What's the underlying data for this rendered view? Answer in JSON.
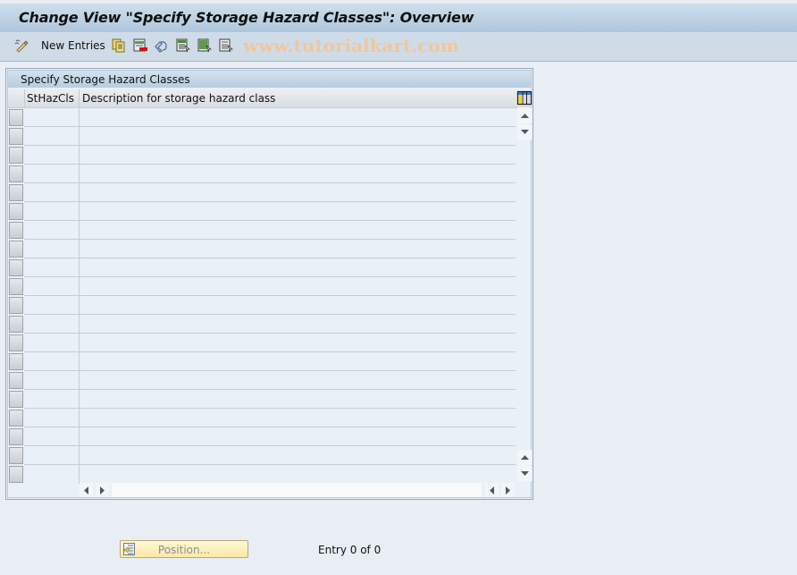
{
  "window": {
    "title": "Change View \"Specify Storage Hazard Classes\": Overview"
  },
  "toolbar": {
    "items": [
      {
        "icon": "edit-pencil-icon",
        "label": ""
      },
      {
        "icon": "",
        "label": "New Entries"
      },
      {
        "icon": "copy-as-icon",
        "label": ""
      },
      {
        "icon": "delete-icon",
        "label": ""
      },
      {
        "icon": "undo-change-icon",
        "label": ""
      },
      {
        "icon": "select-all-icon",
        "label": ""
      },
      {
        "icon": "select-block-icon",
        "label": ""
      },
      {
        "icon": "deselect-all-icon",
        "label": ""
      }
    ],
    "new_entries_label": "New Entries",
    "watermark": "www.tutorialkart.com"
  },
  "table": {
    "title": "Specify Storage Hazard Classes",
    "columns": [
      {
        "key": "sthazcls",
        "label": "StHazCls"
      },
      {
        "key": "description",
        "label": "Description for storage hazard class"
      }
    ],
    "rows": [],
    "visible_empty_rows": 20,
    "column_settings_icon": "table-settings-icon"
  },
  "footer": {
    "position_button_label": "Position...",
    "entry_status": "Entry 0 of 0"
  },
  "colors": {
    "title_bar_top": "#cfdfeb",
    "title_bar_bottom": "#afc7dd",
    "toolbar_bg": "#cfdce7",
    "background": "#e9eef5",
    "watermark": "#f0c79b",
    "position_button_bg": "#fde9a6"
  }
}
